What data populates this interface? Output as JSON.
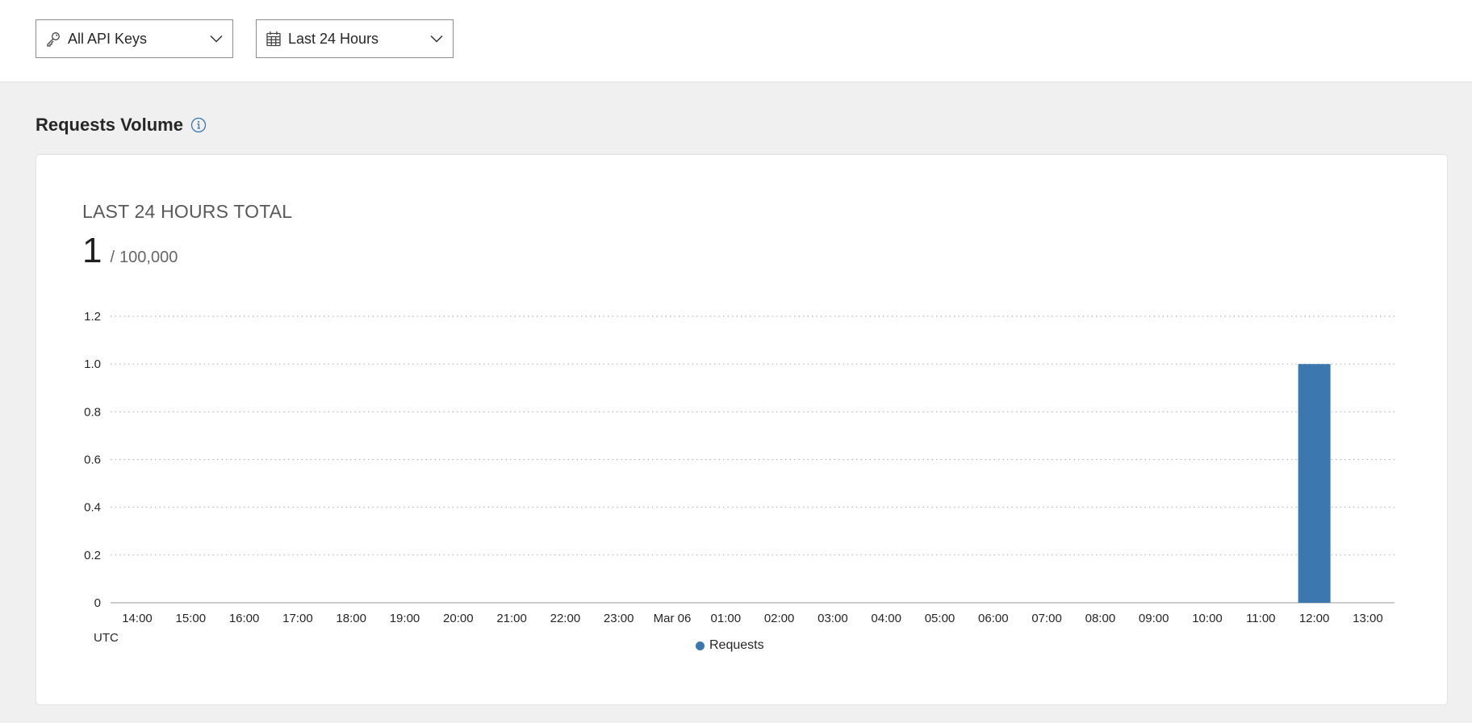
{
  "filters": {
    "api_keys": {
      "label": "All API Keys",
      "icon": "key-icon"
    },
    "time_range": {
      "label": "Last 24 Hours",
      "icon": "calendar-icon"
    }
  },
  "section": {
    "title": "Requests Volume",
    "info_icon": "info-icon"
  },
  "summary": {
    "label": "LAST 24 HOURS TOTAL",
    "value": "1",
    "separator": "/",
    "limit": "100,000"
  },
  "colors": {
    "accent": "#3d77af",
    "grid": "#b5b5b5"
  },
  "chart_data": {
    "type": "bar",
    "categories": [
      "14:00",
      "15:00",
      "16:00",
      "17:00",
      "18:00",
      "19:00",
      "20:00",
      "21:00",
      "22:00",
      "23:00",
      "Mar 06",
      "01:00",
      "02:00",
      "03:00",
      "04:00",
      "05:00",
      "06:00",
      "07:00",
      "08:00",
      "09:00",
      "10:00",
      "11:00",
      "12:00",
      "13:00"
    ],
    "series": [
      {
        "name": "Requests",
        "values": [
          0,
          0,
          0,
          0,
          0,
          0,
          0,
          0,
          0,
          0,
          0,
          0,
          0,
          0,
          0,
          0,
          0,
          0,
          0,
          0,
          0,
          0,
          1,
          0
        ]
      }
    ],
    "y_ticks": [
      "0",
      "0.2",
      "0.4",
      "0.6",
      "0.8",
      "1.0",
      "1.2"
    ],
    "ylim": [
      0,
      1.2
    ],
    "x_axis_note": "UTC",
    "grid": true,
    "legend_position": "bottom-center"
  }
}
